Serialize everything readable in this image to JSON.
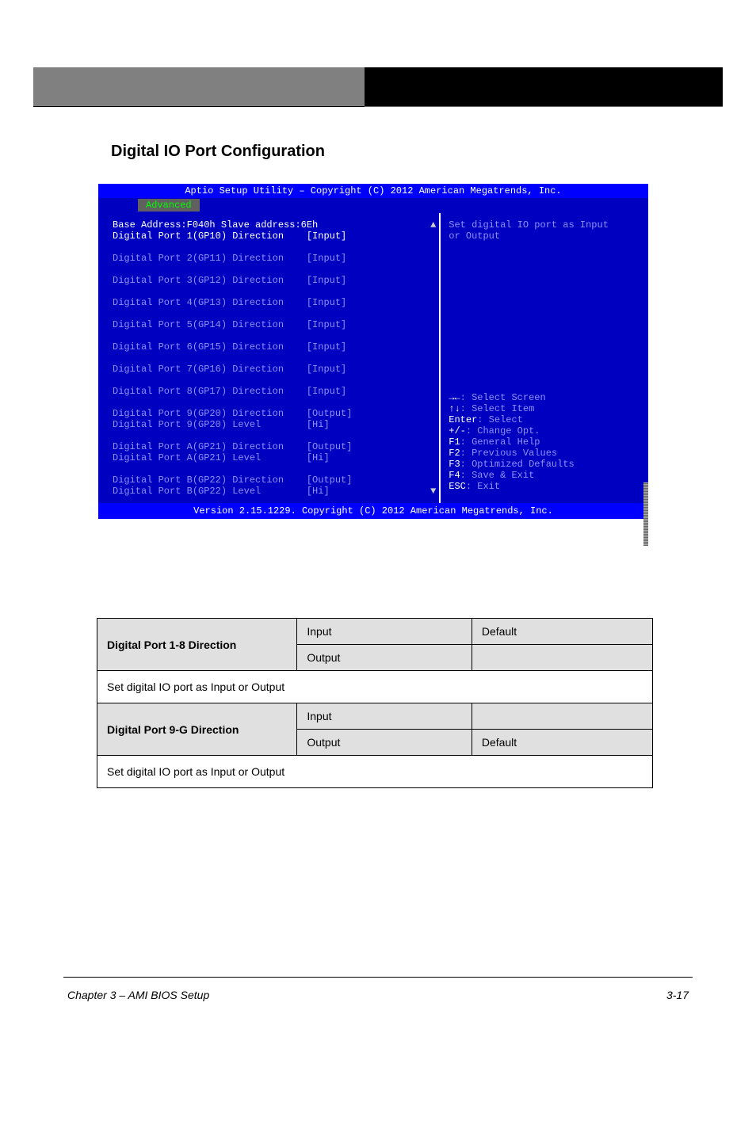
{
  "section_heading": "Digital IO Port Configuration",
  "bios": {
    "title": "Aptio Setup Utility – Copyright (C) 2012 American Megatrends, Inc.",
    "tab_active": "Advanced",
    "footer": "Version 2.15.1229. Copyright (C) 2012 American Megatrends, Inc.",
    "header_line": "Base Address:F040h  Slave address:6Eh",
    "rows": [
      {
        "label": "Digital Port 1(GP10) Direction",
        "value": "[Input]",
        "hl": true
      },
      {
        "spacer": true
      },
      {
        "label": "Digital Port 2(GP11) Direction",
        "value": "[Input]",
        "hl": false
      },
      {
        "spacer": true
      },
      {
        "label": "Digital Port 3(GP12) Direction",
        "value": "[Input]",
        "hl": false
      },
      {
        "spacer": true
      },
      {
        "label": "Digital Port 4(GP13) Direction",
        "value": "[Input]",
        "hl": false
      },
      {
        "spacer": true
      },
      {
        "label": "Digital Port 5(GP14) Direction",
        "value": "[Input]",
        "hl": false
      },
      {
        "spacer": true
      },
      {
        "label": "Digital Port 6(GP15) Direction",
        "value": "[Input]",
        "hl": false
      },
      {
        "spacer": true
      },
      {
        "label": "Digital Port 7(GP16) Direction",
        "value": "[Input]",
        "hl": false
      },
      {
        "spacer": true
      },
      {
        "label": "Digital Port 8(GP17) Direction",
        "value": "[Input]",
        "hl": false
      },
      {
        "spacer": true
      },
      {
        "label": "Digital Port 9(GP20) Direction",
        "value": "[Output]",
        "hl": false
      },
      {
        "label": "Digital Port 9(GP20) Level",
        "value": "[Hi]",
        "hl": false
      },
      {
        "spacer": true
      },
      {
        "label": "Digital Port A(GP21) Direction",
        "value": "[Output]",
        "hl": false
      },
      {
        "label": "Digital Port A(GP21) Level",
        "value": "[Hi]",
        "hl": false
      },
      {
        "spacer": true
      },
      {
        "label": "Digital Port B(GP22) Direction",
        "value": "[Output]",
        "hl": false
      },
      {
        "label": "Digital Port B(GP22) Level",
        "value": "[Hi]",
        "hl": false
      }
    ],
    "help_top": [
      "Set digital IO port as Input",
      "or Output"
    ],
    "help_keys": [
      {
        "k": "→←",
        "t": ": Select Screen"
      },
      {
        "k": "↑↓",
        "t": ": Select Item"
      },
      {
        "k": "Enter",
        "t": ": Select"
      },
      {
        "k": "+/-",
        "t": ": Change Opt."
      },
      {
        "k": "F1",
        "t": ": General Help"
      },
      {
        "k": "F2",
        "t": ": Previous Values"
      },
      {
        "k": "F3",
        "t": ": Optimized Defaults"
      },
      {
        "k": "F4",
        "t": ": Save & Exit"
      },
      {
        "k": "ESC",
        "t": ": Exit"
      }
    ]
  },
  "table": {
    "row1": {
      "label": "Digital Port 1-8 Direction",
      "c1": "Input",
      "c2": "Default",
      "c3": "Output",
      "c4": ""
    },
    "desc1": "Set digital IO port as Input or Output",
    "row2": {
      "label": "Digital Port 9-G Direction",
      "c1": "Input",
      "c2": "",
      "c3": "Output",
      "c4": "Default"
    },
    "desc2": "Set digital IO port as Input or Output"
  },
  "footer": {
    "left": "Chapter 3 – AMI BIOS Setup",
    "right": "3-17"
  }
}
